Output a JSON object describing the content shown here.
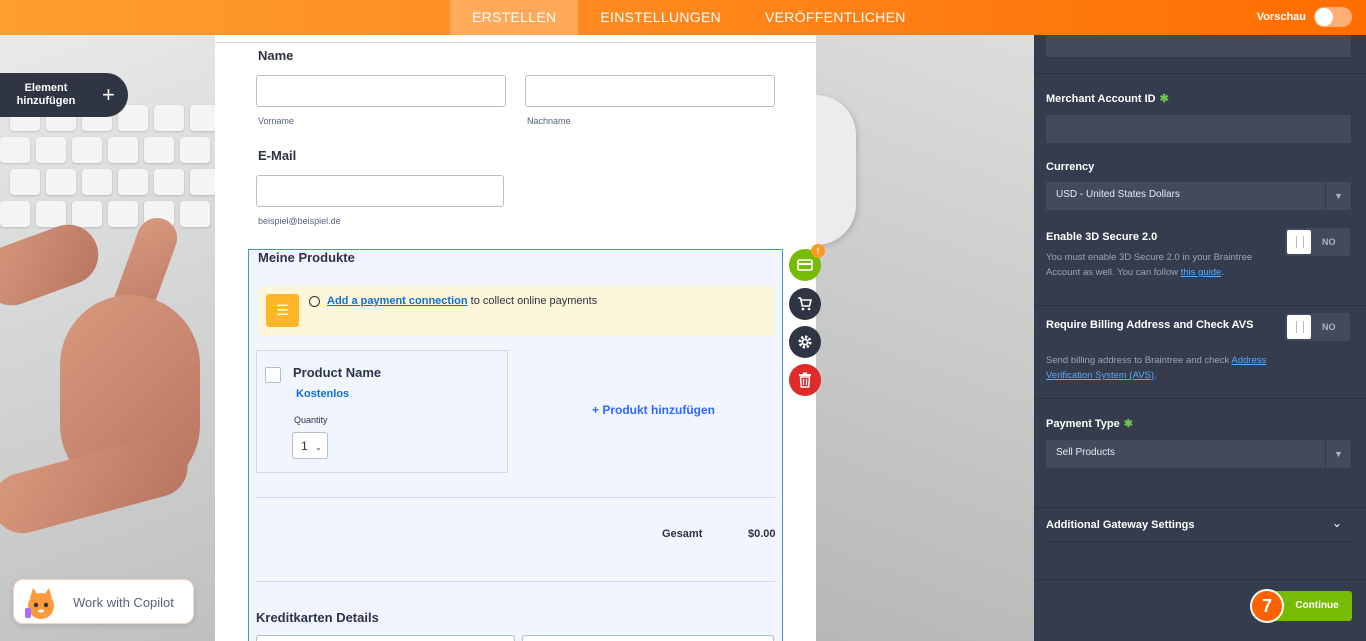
{
  "topbar": {
    "tabs": [
      {
        "label": "ERSTELLEN",
        "active": true
      },
      {
        "label": "EINSTELLUNGEN",
        "active": false
      },
      {
        "label": "VERÖFFENTLICHEN",
        "active": false
      }
    ],
    "preview_label": "Vorschau"
  },
  "add_element": {
    "label": "Element hinzufügen",
    "icon": "plus-icon"
  },
  "form": {
    "name_label": "Name",
    "first_name_sublabel": "Vorname",
    "last_name_sublabel": "Nachname",
    "email_label": "E-Mail",
    "email_sublabel": "beispiel@beispiel.de",
    "products": {
      "title": "Meine Produkte",
      "warning_link": "Add a payment connection",
      "warning_text": " to collect online payments",
      "product_name": "Product Name",
      "product_price": "Kostenlos",
      "quantity_label": "Quantity",
      "quantity_value": "1",
      "add_product": "+ Produkt hinzufügen",
      "total_label": "Gesamt",
      "total_value": "$0.00",
      "credit_card_title": "Kreditkarten Details"
    }
  },
  "tools": {
    "badge": "!"
  },
  "panel": {
    "merchant_label": "Merchant Account ID",
    "currency_label": "Currency",
    "currency_value": "USD - United States Dollars",
    "secure_label": "Enable 3D Secure 2.0",
    "secure_desc": "You must enable 3D Secure 2.0 in your Braintree Account as well. You can follow ",
    "secure_link": "this guide",
    "secure_desc_end": ".",
    "secure_toggle": "NO",
    "billing_label": "Require Billing Address and Check AVS",
    "billing_desc": "Send billing address to Braintree and check ",
    "billing_link": "Address Verification System (AVS)",
    "billing_desc_end": ".",
    "billing_toggle": "NO",
    "payment_type_label": "Payment Type",
    "payment_type_value": "Sell Products",
    "additional_label": "Additional Gateway Settings",
    "continue_label": "Continue",
    "step_number": "7"
  },
  "copilot": {
    "label": "Work with Copilot"
  },
  "colors": {
    "accent": "#ff8a1f",
    "continue": "#78bb07",
    "panel": "#343c4e",
    "link": "#0b6fd8"
  }
}
